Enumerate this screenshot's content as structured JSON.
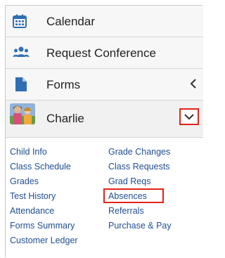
{
  "nav": {
    "calendar": "Calendar",
    "request_conference": "Request Conference",
    "forms": "Forms"
  },
  "student": {
    "name": "Charlie"
  },
  "links": {
    "col1": [
      "Child Info",
      "Class Schedule",
      "Grades",
      "Test History",
      "Attendance",
      "Forms Summary",
      "Customer Ledger"
    ],
    "col2": [
      "Grade Changes",
      "Class Requests",
      "Grad Reqs",
      "Absences",
      "Referrals",
      "Purchase & Pay"
    ]
  },
  "icons": {
    "calendar": "calendar-icon",
    "request_conference": "people-icon",
    "forms": "document-icon",
    "forms_chevron": "chevron-left-icon",
    "student_chevron": "chevron-down-icon"
  },
  "colors": {
    "icon": "#2f6fb3",
    "link": "#1f4e92",
    "highlight": "#e2231a"
  }
}
